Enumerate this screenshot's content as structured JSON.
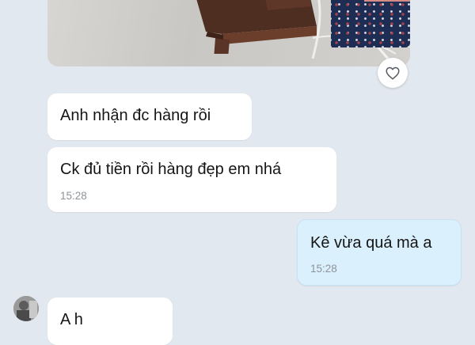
{
  "messages": [
    {
      "text": "Anh nhận đc hàng rồi",
      "time": ""
    },
    {
      "text": "Ck đủ tiền rồi hàng đẹp em nhá",
      "time": "15:28"
    },
    {
      "text": "Kê vừa quá mà a",
      "time": "15:28"
    },
    {
      "text": "A h",
      "time": ""
    }
  ],
  "icons": {
    "like": "heart-icon"
  },
  "colors": {
    "background": "#e2e8ef",
    "incoming_bubble": "#ffffff",
    "outgoing_bubble": "#dbf0fd",
    "time_text": "#8e9399"
  }
}
